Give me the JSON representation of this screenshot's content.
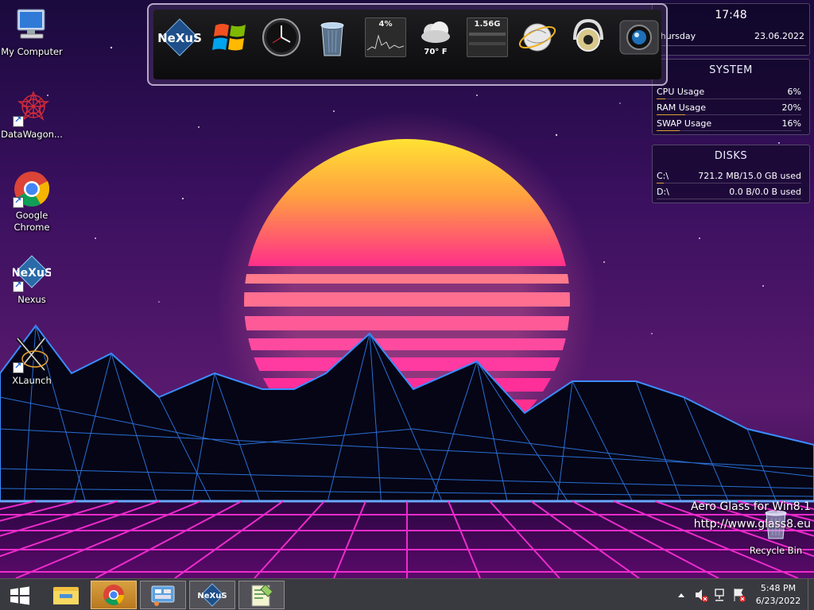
{
  "desktop": {
    "icons": [
      {
        "label": "My Computer"
      },
      {
        "label": "DataWagon..."
      },
      {
        "label": "Google Chrome"
      },
      {
        "label": "Nexus"
      },
      {
        "label": "XLaunch"
      },
      {
        "label": "Recycle Bin"
      }
    ],
    "watermark": {
      "line1": "Aero Glass for Win8.1",
      "line2": "http://www.glass8.eu"
    }
  },
  "dock": {
    "logo_text": "NeXuS",
    "cpu_meter": "4%",
    "weather_temp": "70° F",
    "memory_meter": "1.56G",
    "items": [
      "nexus-logo-icon",
      "windows-flag-icon",
      "clock-icon",
      "recycle-bin-icon",
      "cpu-meter-icon",
      "weather-icon",
      "memory-meter-icon",
      "network-globe-icon",
      "speaker-icon",
      "camera-icon"
    ]
  },
  "clock_widget": {
    "time": "17:48",
    "day": "Thursday",
    "date": "23.06.2022"
  },
  "system_panel": {
    "title": "SYSTEM",
    "rows": [
      {
        "label": "CPU Usage",
        "value": "6%",
        "fraction": 0.06
      },
      {
        "label": "RAM Usage",
        "value": "20%",
        "fraction": 0.2
      },
      {
        "label": "SWAP Usage",
        "value": "16%",
        "fraction": 0.16
      }
    ]
  },
  "disks_panel": {
    "title": "DISKS",
    "rows": [
      {
        "label": "C:\\",
        "value": "721.2 MB/15.0 GB used",
        "fraction": 0.05
      },
      {
        "label": "D:\\",
        "value": "0.0 B/0.0 B used",
        "fraction": 0.0
      }
    ]
  },
  "taskbar": {
    "start": "windows-start-icon",
    "items": [
      "file-explorer-icon",
      "chrome-icon",
      "control-panel-icon",
      "nexus-icon",
      "notepad-icon"
    ],
    "tray_time": "5:48 PM",
    "tray_date": "6/23/2022"
  },
  "colors": {
    "accent_bar": "#e0a030",
    "taskbar_active": "#d8a040"
  }
}
